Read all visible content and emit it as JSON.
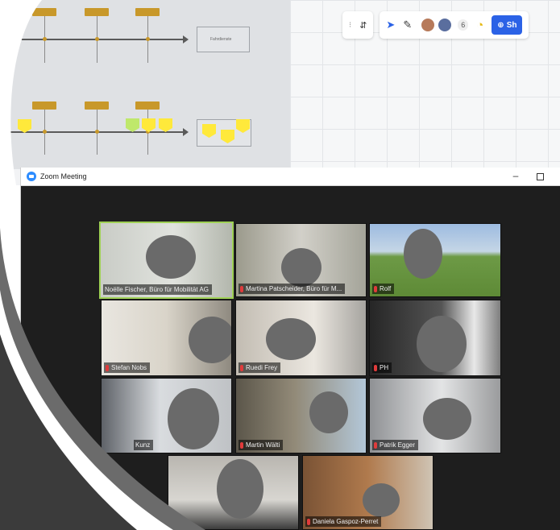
{
  "whiteboard": {
    "frame_label": "Fahrdienste",
    "toolbar": {
      "participant_count": "6",
      "share_label": "Sh"
    }
  },
  "zoom": {
    "window_title": "Zoom Meeting",
    "minimize": "–",
    "participants": [
      {
        "name": "Noëlle Fischer, Büro für Mobilität AG"
      },
      {
        "name": "Martina Patscheider, Büro für M..."
      },
      {
        "name": "Rolf"
      },
      {
        "name": "Stefan Nobs"
      },
      {
        "name": "Ruedi Frey"
      },
      {
        "name": "PH"
      },
      {
        "name": "Kunz"
      },
      {
        "name": "Martin Wälti"
      },
      {
        "name": "Patrik Egger"
      },
      {
        "name": ""
      },
      {
        "name": "Daniela Gaspoz-Perret"
      }
    ]
  },
  "colors": {
    "active_speaker": "#9fd155",
    "zoom_blue": "#2d8cff",
    "timeline_tag": "#c8982a",
    "sticky": "#ffe93b"
  }
}
